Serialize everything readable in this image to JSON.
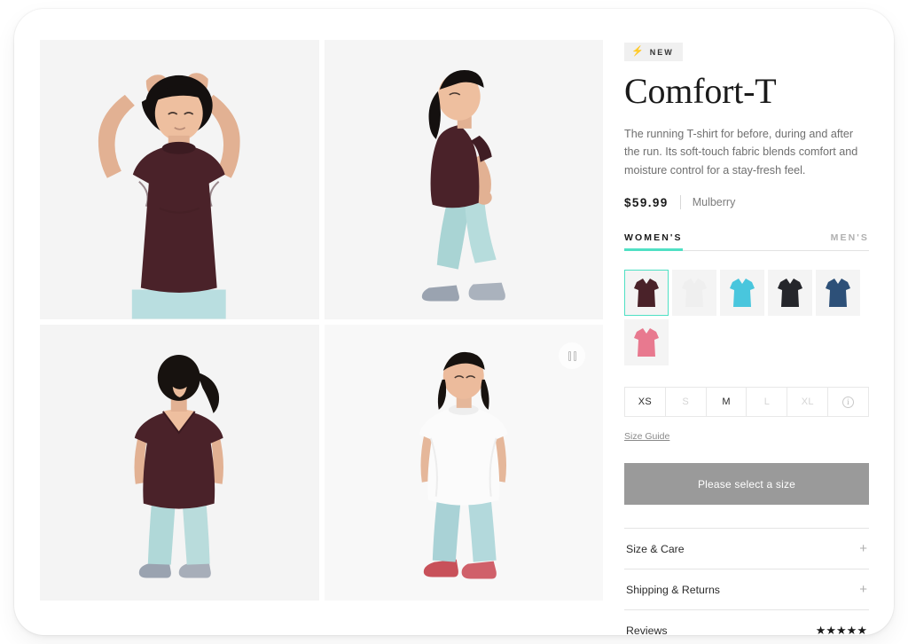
{
  "product": {
    "badge": {
      "icon": "lightning-bolt-icon",
      "label": "NEW"
    },
    "title": "Comfort-T",
    "description": "The running T-shirt for before, during and after the run. Its soft-touch fabric blends comfort and moisture control for a stay-fresh feel.",
    "price": "$59.99",
    "color_name": "Mulberry"
  },
  "tabs": [
    {
      "label": "WOMEN'S",
      "active": true
    },
    {
      "label": "MEN'S",
      "active": false
    }
  ],
  "colors": [
    {
      "name": "Mulberry",
      "hex": "#4a2229",
      "selected": true
    },
    {
      "name": "White",
      "hex": "#efefef",
      "selected": false
    },
    {
      "name": "Cyan",
      "hex": "#49c6dd",
      "selected": false
    },
    {
      "name": "Black",
      "hex": "#25262b",
      "selected": false
    },
    {
      "name": "Navy",
      "hex": "#2d5078",
      "selected": false
    },
    {
      "name": "Pink",
      "hex": "#e8798f",
      "selected": false
    }
  ],
  "sizes": [
    {
      "label": "XS",
      "available": true
    },
    {
      "label": "S",
      "available": false
    },
    {
      "label": "M",
      "available": true
    },
    {
      "label": "L",
      "available": false
    },
    {
      "label": "XL",
      "available": false
    }
  ],
  "size_info_icon": "info-icon",
  "size_guide_label": "Size Guide",
  "cta": {
    "label": "Please select a size",
    "enabled": false,
    "color": "#9a9a9a"
  },
  "accordion": [
    {
      "label": "Size & Care",
      "control": "+"
    },
    {
      "label": "Shipping & Returns",
      "control": "+"
    }
  ],
  "reviews": {
    "label": "Reviews",
    "stars": "★★★★★",
    "rating": 5
  },
  "gallery": [
    {
      "alt": "Model with hands behind head wearing mulberry T-shirt",
      "type": "image"
    },
    {
      "alt": "Side profile of model walking in mulberry T-shirt",
      "type": "image"
    },
    {
      "alt": "Back view of model in mulberry T-shirt with V-back",
      "type": "image"
    },
    {
      "alt": "Model standing in white T-shirt",
      "type": "video",
      "control": "pause-icon"
    }
  ],
  "theme": {
    "accent": "#4fe0c4",
    "tile_bg": "#f4f4f4",
    "text": "#1a1a1a",
    "muted": "#7c7c7c"
  }
}
